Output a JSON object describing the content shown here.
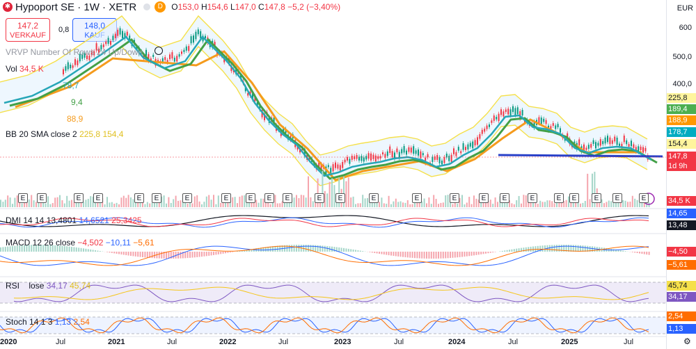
{
  "header": {
    "title": "Hypoport SE · 1W · XETR",
    "d_badge": "D",
    "ohlc": {
      "o_label": "O",
      "o": "153,0",
      "h_label": "H",
      "h": "154,6",
      "l_label": "L",
      "l": "147,0",
      "c_label": "C",
      "c": "147,8",
      "chg": "−5,2 (−3,40%)"
    }
  },
  "trade": {
    "sell_price": "147,2",
    "sell_label": "VERKAUF",
    "spread": "0,8",
    "buy_price": "148,0",
    "buy_label": "KAUF"
  },
  "indicators": {
    "vrvp": "VRVP Number Of Rows 24 Up/Down",
    "vol_label": "Vol",
    "vol_value": "34,5 K",
    "ma1": "78,7",
    "ma2": "9,4",
    "ma3": "88,9",
    "bb_label": "BB 20 SMA close 2",
    "bb_upper": "225,8",
    "bb_lower": "154,4",
    "dmi_label": "DMI 14 14",
    "dmi_adx": "13,4801",
    "dmi_plus": "14,6521",
    "dmi_minus": "25,3425",
    "macd_label": "MACD 12 26 close",
    "macd_v1": "−4,502",
    "macd_v2": "−10,11",
    "macd_v3": "−5,61",
    "rsi_label": "RSI",
    "rsi_close": "lose",
    "rsi_v1": "34,17",
    "rsi_v2": "45,74",
    "stoch_label": "Stoch 14 1 3",
    "stoch_v1": "1,13",
    "stoch_v2": "2,54"
  },
  "price_axis": {
    "currency": "EUR",
    "ticks": [
      "600",
      "500,0",
      "400,0"
    ],
    "tags": [
      {
        "text": "225,8",
        "bg": "#fff59d",
        "fg": "#131722"
      },
      {
        "text": "189,4",
        "bg": "#4caf50",
        "fg": "#ffffff"
      },
      {
        "text": "188,9",
        "bg": "#ff9800",
        "fg": "#ffffff"
      },
      {
        "text": "178,7",
        "bg": "#00acc1",
        "fg": "#ffffff"
      },
      {
        "text": "154,4",
        "bg": "#fff59d",
        "fg": "#131722"
      },
      {
        "text": "147,8",
        "bg": "#f23645",
        "fg": "#ffffff"
      },
      {
        "text": "1d 9h",
        "bg": "#f23645",
        "fg": "#ffffff"
      }
    ],
    "vol_tag": "34,5 K",
    "dmi_tags": [
      "14,65",
      "13,48"
    ],
    "macd_tags": [
      "−4,50",
      "−5,61"
    ],
    "rsi_tags": [
      "45,74",
      "34,17"
    ],
    "stoch_tags": [
      "2,54",
      "1,13"
    ]
  },
  "time_axis": [
    "2020",
    "Jul",
    "2021",
    "Jul",
    "2022",
    "Jul",
    "2023",
    "Jul",
    "2024",
    "Jul",
    "2025",
    "Jul"
  ],
  "earnings_marker": "E",
  "colors": {
    "up": "#089981",
    "down": "#f23645",
    "ma_teal": "#26a6b7",
    "ma_green": "#43a047",
    "ma_orange": "#f59b1d",
    "bb": "#f5e04a",
    "support": "#2940c8"
  }
}
